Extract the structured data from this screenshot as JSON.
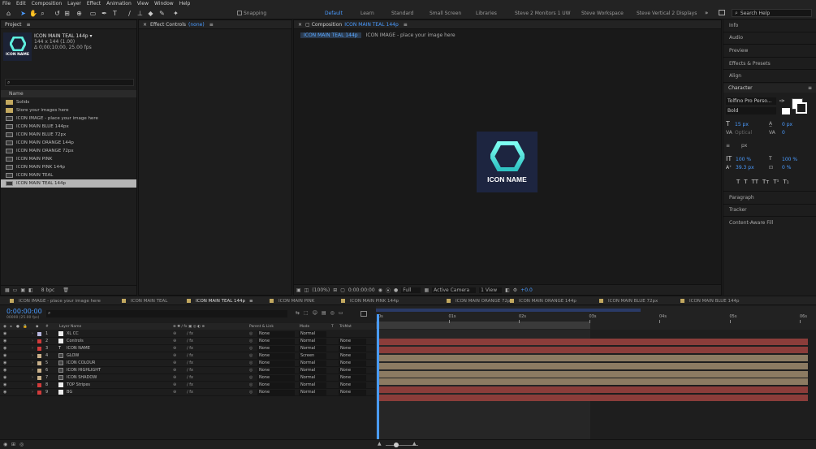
{
  "menu": [
    "File",
    "Edit",
    "Composition",
    "Layer",
    "Effect",
    "Animation",
    "View",
    "Window",
    "Help"
  ],
  "toolbar": {
    "snapping": "Snapping",
    "workspaces": [
      "Default",
      "Learn",
      "Standard",
      "Small Screen",
      "Libraries",
      "Steve 2 Monitors 1 UW",
      "Steve Workspace",
      "Steve Vertical 2 Displays"
    ],
    "search_placeholder": "Search Help"
  },
  "project": {
    "tab": "Project",
    "comp_name": "ICON MAIN TEAL 144p ▾",
    "comp_size": "144 x 144 (1.00)",
    "comp_dur": "Δ 0;00;10;00, 25.00 fps",
    "thumb_label": "ICON NAME",
    "col_name": "Name",
    "bpc": "8 bpc",
    "items": [
      {
        "name": "Solids",
        "kind": "folder"
      },
      {
        "name": "Store your images here",
        "kind": "folder"
      },
      {
        "name": "ICON IMAGE - place your image here",
        "kind": "comp"
      },
      {
        "name": "ICON MAIN BLUE 144px",
        "kind": "comp"
      },
      {
        "name": "ICON MAIN BLUE 72px",
        "kind": "comp"
      },
      {
        "name": "ICON MAIN ORANGE 144p",
        "kind": "comp"
      },
      {
        "name": "ICON MAIN ORANGE 72px",
        "kind": "comp"
      },
      {
        "name": "ICON MAIN PINK",
        "kind": "comp"
      },
      {
        "name": "ICON MAIN PINK 144p",
        "kind": "comp"
      },
      {
        "name": "ICON MAIN TEAL",
        "kind": "comp"
      },
      {
        "name": "ICON MAIN TEAL 144p",
        "kind": "comp",
        "selected": true
      }
    ]
  },
  "effects": {
    "tab": "Effect Controls",
    "value": "(none)"
  },
  "comp": {
    "tab": "Composition",
    "comp_name": "ICON MAIN TEAL 144p",
    "breadcrumb1": "ICON MAIN TEAL 144p",
    "breadcrumb2": "ICON IMAGE - place your image here",
    "icon_label": "ICON NAME",
    "footer": {
      "zoom": "(100%)",
      "time": "0:00:00:00",
      "res": "Full",
      "camera": "Active Camera",
      "view": "1 View",
      "exposure": "+0.0"
    }
  },
  "right": {
    "panels": [
      "Info",
      "Audio",
      "Preview",
      "Effects & Presets",
      "Align"
    ],
    "character": "Character",
    "font": "Tolfino Pro Perso...",
    "style": "Bold",
    "size": "15 px",
    "leading": "0 px",
    "kerning": "Optical",
    "tracking": "0",
    "stroke": "px",
    "vscale": "100 %",
    "hscale": "100 %",
    "baseline": "39.3 px",
    "tsume": "0 %",
    "styles": [
      "T",
      "T",
      "TT",
      "Tт",
      "T¹",
      "T₁"
    ],
    "panels2": [
      "Paragraph",
      "Tracker",
      "Content-Aware Fill"
    ]
  },
  "timeline": {
    "tabs": [
      "ICON IMAGE - place your image here",
      "ICON MAIN TEAL",
      "ICON MAIN TEAL 144p",
      "ICON MAIN PINK",
      "ICON MAIN PINK 144p",
      "ICON MAIN ORANGE 72px",
      "ICON MAIN ORANGE 144p",
      "ICON MAIN BLUE 72px",
      "ICON MAIN BLUE 144p"
    ],
    "timecode": "0:00:00:00",
    "frames": "00000 (25.00 fps)",
    "col_layer": "Layer Name",
    "col_parent": "Parent & Link",
    "col_mode": "Mode",
    "col_t": "T",
    "col_trk": "TrkMat",
    "ruler": [
      "0s",
      "01s",
      "02s",
      "03s",
      "04s",
      "05s",
      "06s"
    ],
    "layers": [
      {
        "num": "1",
        "name": "XL CC",
        "color": "#b8b8e0",
        "type": "solid",
        "parent": "None",
        "mode": "Normal",
        "trk": "",
        "bar": "none"
      },
      {
        "num": "2",
        "name": "Controls",
        "color": "#d23b3b",
        "type": "solid",
        "parent": "None",
        "mode": "Normal",
        "trk": "None",
        "bar": "red"
      },
      {
        "num": "3",
        "name": "ICON NAME",
        "color": "#d23b3b",
        "type": "text",
        "parent": "None",
        "mode": "Normal",
        "trk": "None",
        "bar": "red"
      },
      {
        "num": "4",
        "name": "GLOW",
        "color": "#c8b08a",
        "type": "comp",
        "parent": "None",
        "mode": "Screen",
        "trk": "None",
        "bar": "tan"
      },
      {
        "num": "5",
        "name": "ICON COLOUR",
        "color": "#c8b08a",
        "type": "comp",
        "parent": "None",
        "mode": "Normal",
        "trk": "None",
        "bar": "tan"
      },
      {
        "num": "6",
        "name": "ICON HIGHLIGHT",
        "color": "#c8b08a",
        "type": "comp",
        "parent": "None",
        "mode": "Normal",
        "trk": "None",
        "bar": "tan"
      },
      {
        "num": "7",
        "name": "ICON SHADOW",
        "color": "#c8b08a",
        "type": "comp",
        "parent": "None",
        "mode": "Normal",
        "trk": "None",
        "bar": "tan"
      },
      {
        "num": "8",
        "name": "TOP Stripes",
        "color": "#d23b3b",
        "type": "solid",
        "parent": "None",
        "mode": "Normal",
        "trk": "None",
        "bar": "red"
      },
      {
        "num": "9",
        "name": "BG",
        "color": "#d23b3b",
        "type": "solid",
        "parent": "None",
        "mode": "Normal",
        "trk": "None",
        "bar": "red"
      }
    ]
  }
}
